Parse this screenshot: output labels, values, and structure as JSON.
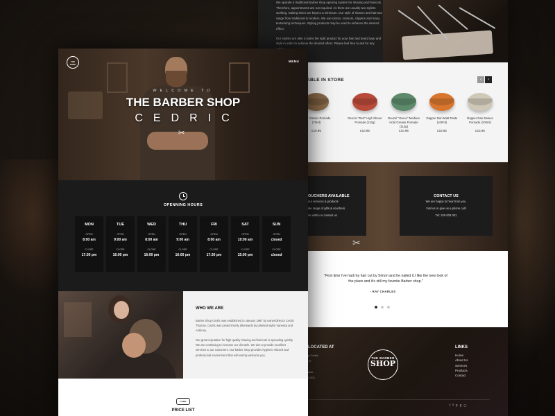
{
  "back": {
    "intro_paragraphs": [
      "We operate a traditional barber shop opening system for shaving and haircuts. Therefore, appointments are not required. As there are usually two stylists working, waiting times are kept to a minimum. Our style of shaves and haircuts range from traditional to modern. We use razors, scissors, clippers and many texturising techniques. Styling products may be used to enhance the desired effect.",
      "Our stylists are able to tailor the right product for your hair and beard type and style in order to achieve the desired effect. Please feel free to ask for any advice."
    ],
    "products_title": "ABLE IN STORE",
    "prev_label": "‹",
    "next_label": "›",
    "products": [
      {
        "name": "Byrd Classic Pomade (70ml)",
        "price": "£19.95",
        "color": "#8a6a4a",
        "brand": "UYIO"
      },
      {
        "name": "Reuzel \"Red\" High Sheen Pomade (113g)",
        "price": "£10.95",
        "color": "#b84a3a",
        "brand": ""
      },
      {
        "name": "Reuzel \"Green\" Medium Hold Grease Pomade (113g)",
        "price": "£10.95",
        "color": "#5c8a6a",
        "brand": ""
      },
      {
        "name": "Dapper Dan Matt Paste (100ml)",
        "price": "£15.95",
        "color": "#d8762e",
        "brand": ""
      },
      {
        "name": "Dapper Dan Deluxe Pomade (100ml)",
        "price": "£15.95",
        "color": "#cfc8b8",
        "brand": ""
      }
    ],
    "vouchers": {
      "title": "OUCHERS AVAILABLE",
      "lines": [
        "our services & products",
        "ide range of gifts & vouchers.",
        "ire within or contact us"
      ]
    },
    "contact": {
      "title": "CONTACT US",
      "lines": [
        "We are happy to hear from you.",
        "Visit us or give us a phone call!",
        "Tel: 229 003 001"
      ]
    },
    "testimonial": {
      "quote": "\"First time I've had my hair cut by Simon and he nailed it.I like the new look of the place and it's still my favorite Barber shop.\"",
      "author": "- RAY CHARLES"
    },
    "footer": {
      "located_title": "LOCATED AT",
      "faded_lines": [
        "p Cedric",
        "17",
        "able",
        "3 001"
      ],
      "logo_top": "THE BARBER",
      "logo_main": "SHOP",
      "links_title": "LINKS",
      "links": [
        "Home",
        "About Us",
        "Services",
        "Products",
        "Contact"
      ],
      "social_icons": "twitter-icon facebook-icon pinterest-icon google-plus-icon instagram-icon"
    }
  },
  "front": {
    "hero": {
      "logo_line1": "THE",
      "logo_line2": "SHOP",
      "menu": "MENU",
      "welcome": "WELCOME TO",
      "title": "THE BARBER SHOP",
      "subtitle": "CEDRIC"
    },
    "hours": {
      "title": "OPENNING HOURS",
      "open_label": "OPEN",
      "close_label": "CLOSE",
      "days": [
        {
          "day": "MON",
          "open": "8:00 am",
          "close": "17:30 pm"
        },
        {
          "day": "TUE",
          "open": "9:00 am",
          "close": "16:00 pm"
        },
        {
          "day": "WED",
          "open": "8:00 am",
          "close": "16:00 pm"
        },
        {
          "day": "THU",
          "open": "9:00 am",
          "close": "16:00 pm"
        },
        {
          "day": "FRI",
          "open": "8:00 am",
          "close": "17:30 pm"
        },
        {
          "day": "SAT",
          "open": "10:00 am",
          "close": "15:00 pm"
        },
        {
          "day": "SUN",
          "open": "closed",
          "close": "closed"
        }
      ]
    },
    "who": {
      "title": "WHO WE ARE",
      "paragraphs": [
        "Barber Shop Cedric was established in January 1987 by owner/director Cedric Thomas. Cedric was joined shortly afterwards by talented stylist Vanessa and Anthony.",
        "Our great reputation for high quality shaving and haircuts is spreading quickly. We are continuing to increase our clientele. We aim to provide excellent services to our customers. Our barber shop provides hygienic relaxed and professional environment that will warmly welcome you."
      ]
    },
    "price": {
      "badge": "COMB",
      "title": "PRICE LIST"
    }
  }
}
